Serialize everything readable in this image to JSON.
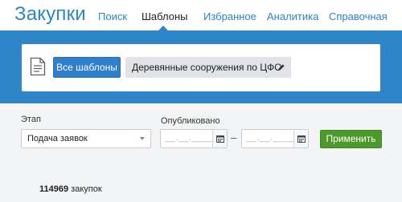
{
  "app": {
    "title": "Закупки"
  },
  "nav": {
    "items": [
      {
        "label": "Поиск",
        "active": false
      },
      {
        "label": "Шаблоны",
        "active": true
      },
      {
        "label": "Избранное",
        "active": false
      },
      {
        "label": "Аналитика",
        "active": false
      },
      {
        "label": "Справочная",
        "active": false
      }
    ]
  },
  "templates": {
    "all_button_label": "Все шаблоны",
    "selected_template": "Деревянные сооружения по ЦФО",
    "icons": {
      "document": "document-icon",
      "edit": "pencil-icon"
    }
  },
  "filters": {
    "stage_label": "Этап",
    "stage_value": "Подача заявок",
    "published_label": "Опубликовано",
    "date_from_placeholder": "__.__.____",
    "date_to_placeholder": "__.__.____",
    "range_separator": "–",
    "apply_label": "Применить"
  },
  "results": {
    "count": "114969",
    "unit": "закупок"
  },
  "colors": {
    "brand_blue": "#2e86c8",
    "apply_green": "#4c9b2a",
    "background": "#f3f4f5"
  }
}
